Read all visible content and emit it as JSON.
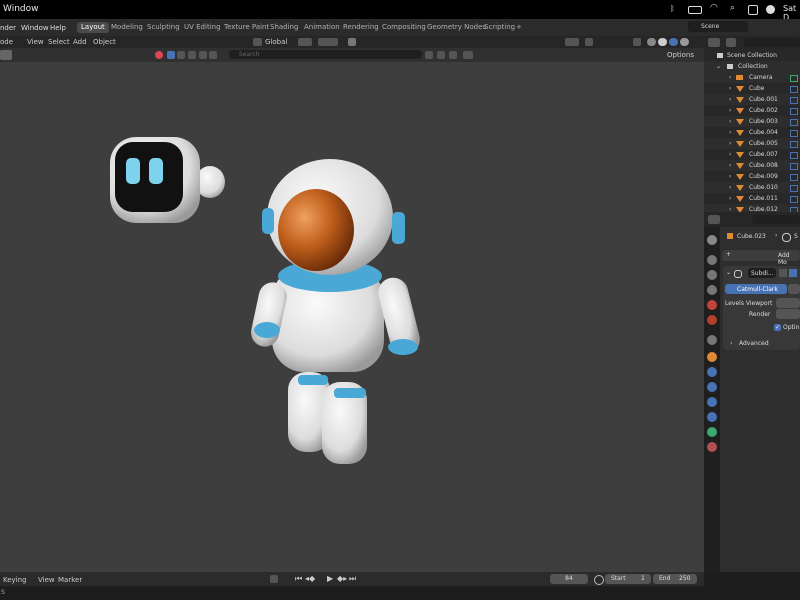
{
  "macbar": {
    "app": "Window",
    "clock": "Sat D"
  },
  "menus": [
    "nder",
    "Window",
    "Help"
  ],
  "workspaces": [
    "Layout",
    "Modeling",
    "Sculpting",
    "UV Editing",
    "Texture Paint",
    "Shading",
    "Animation",
    "Rendering",
    "Compositing",
    "Geometry Nodes",
    "Scripting"
  ],
  "add_workspace": "+",
  "scene": "Scene",
  "viewport": {
    "mode": "ode",
    "menus": [
      "View",
      "Select",
      "Add",
      "Object"
    ],
    "transform": "Global",
    "search_placeholder": "Search",
    "options": "Options"
  },
  "timeline": {
    "keying": "Keying",
    "view": "View",
    "marker": "Marker",
    "frame": "84",
    "start_label": "Start",
    "start": "1",
    "end_label": "End",
    "end": "250"
  },
  "outliner": {
    "root": "Scene Collection",
    "collection": "Collection",
    "items": [
      "Camera",
      "Cube",
      "Cube.001",
      "Cube.002",
      "Cube.003",
      "Cube.004",
      "Cube.005",
      "Cube.007",
      "Cube.008",
      "Cube.009",
      "Cube.010",
      "Cube.011",
      "Cube.012"
    ]
  },
  "properties": {
    "object": "Cube.023",
    "scene_short": "S",
    "add_modifier": "Add Mo",
    "modifier_name": "Subdi...",
    "catmull": "Catmull-Clark",
    "levels_viewport": "Levels Viewport",
    "render": "Render",
    "optimal": "Optin",
    "advanced": "Advanced"
  },
  "status": "S",
  "colors": {
    "accent": "#4772b3",
    "orange": "#e08a35",
    "teal": "#56b6dc"
  }
}
